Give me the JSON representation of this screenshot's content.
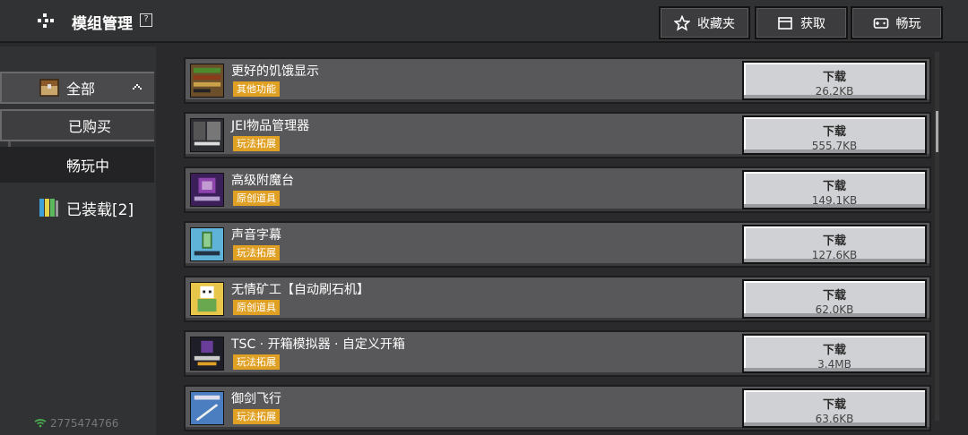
{
  "header": {
    "title": "模组管理",
    "help": "?",
    "buttons": [
      {
        "label": "收藏夹",
        "icon": "star-icon"
      },
      {
        "label": "获取",
        "icon": "chest-icon"
      },
      {
        "label": "畅玩",
        "icon": "gamepad-icon"
      }
    ]
  },
  "sidebar": {
    "all": "全部",
    "bought": "已购买",
    "playing": "畅玩中",
    "installed": "已装载[2]",
    "user_id": "2775474766"
  },
  "download_label": "下载",
  "mods": [
    {
      "title": "更好的饥饿显示",
      "tag": "其他功能",
      "size": "26.2KB",
      "thumb_color": "#6b4f2a"
    },
    {
      "title": "JEI物品管理器",
      "tag": "玩法拓展",
      "size": "555.7KB",
      "thumb_color": "#2b2d33"
    },
    {
      "title": "高级附魔台",
      "tag": "原创道具",
      "size": "149.1KB",
      "thumb_color": "#3a1f58"
    },
    {
      "title": "声音字幕",
      "tag": "玩法拓展",
      "size": "127.6KB",
      "thumb_color": "#5fb3d9"
    },
    {
      "title": "无情矿工【自动刷石机】",
      "tag": "原创道具",
      "size": "62.0KB",
      "thumb_color": "#e8c64a"
    },
    {
      "title": "TSC · 开箱模拟器 · 自定义开箱",
      "tag": "玩法拓展",
      "size": "3.4MB",
      "thumb_color": "#1e1e28"
    },
    {
      "title": "御剑飞行",
      "tag": "玩法拓展",
      "size": "63.6KB",
      "thumb_color": "#4a7ec0"
    }
  ]
}
